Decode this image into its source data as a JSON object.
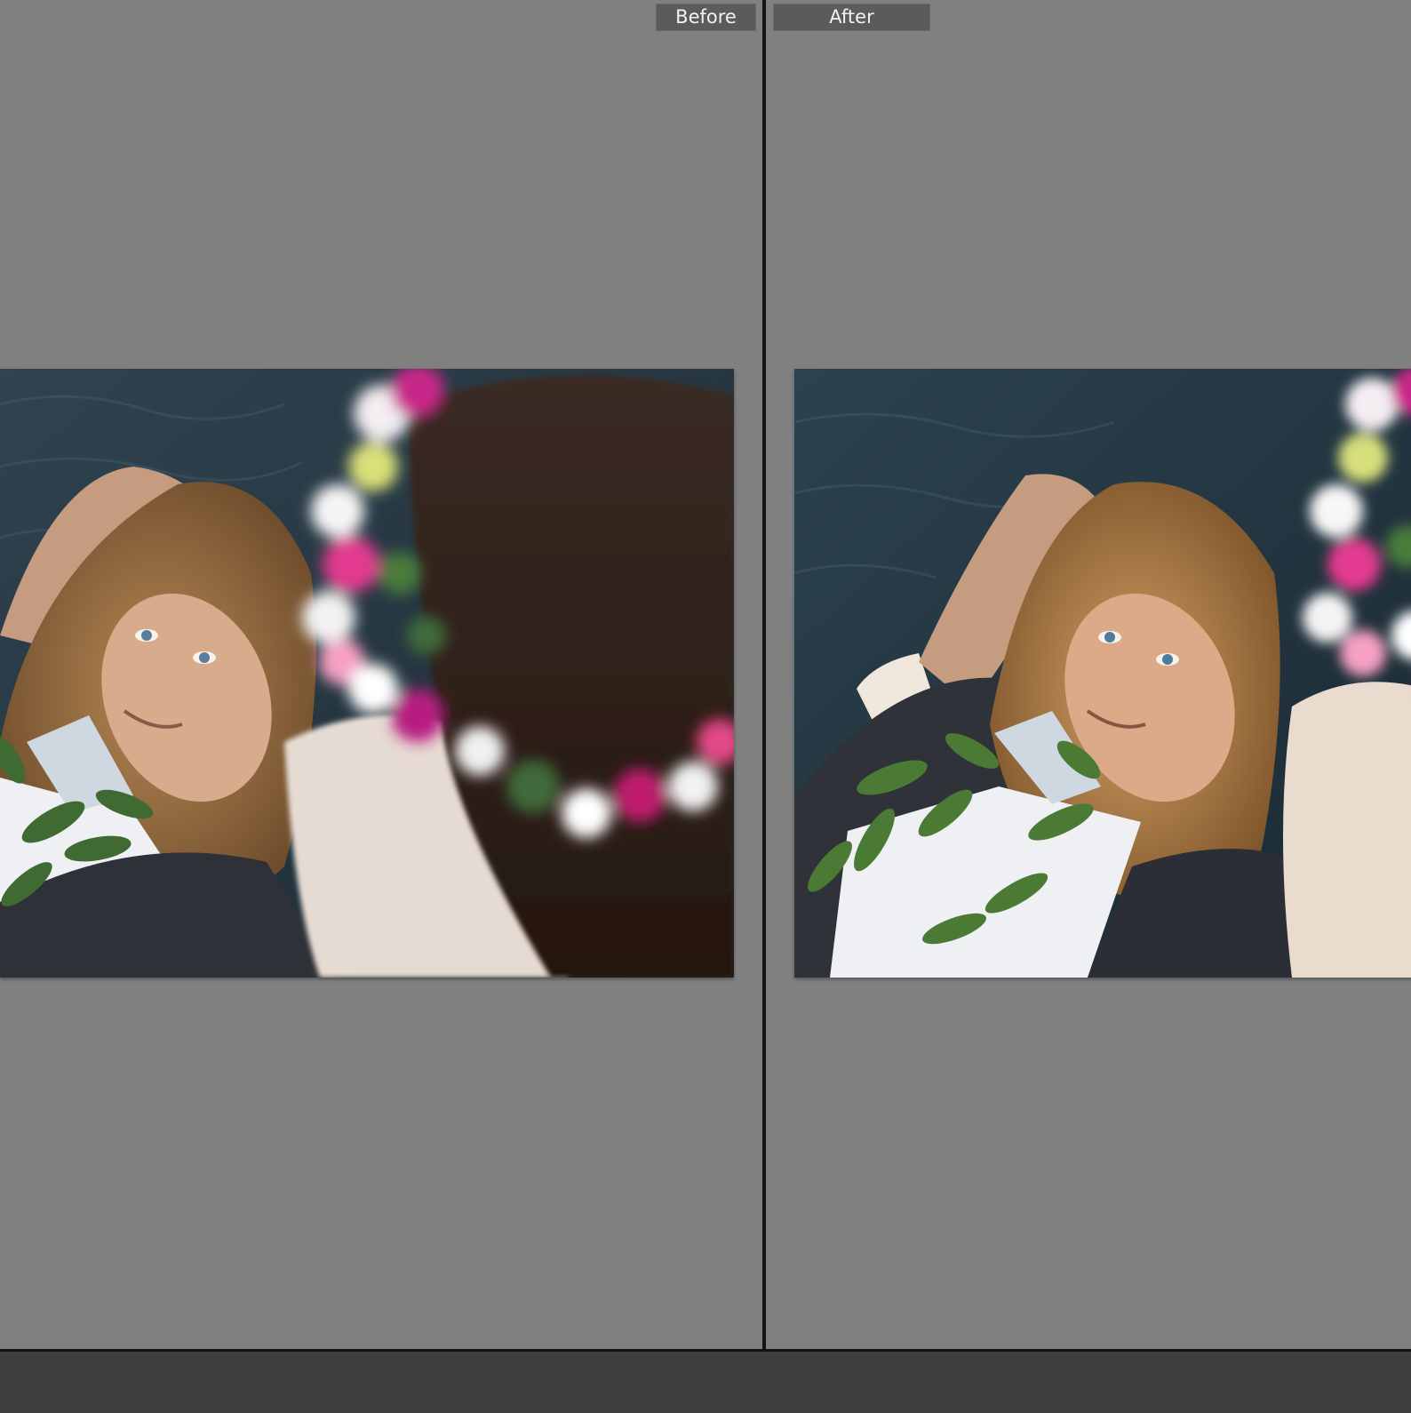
{
  "compare": {
    "before_label": "Before",
    "after_label": "After"
  },
  "colors": {
    "workspace": "#808080",
    "divider": "#141414",
    "label_bg": "#5b5b5b",
    "label_text": "#f2f2f2",
    "bottom_bar": "#3e3e3e"
  },
  "icons": [
    "before-photo-image",
    "after-photo-image"
  ]
}
